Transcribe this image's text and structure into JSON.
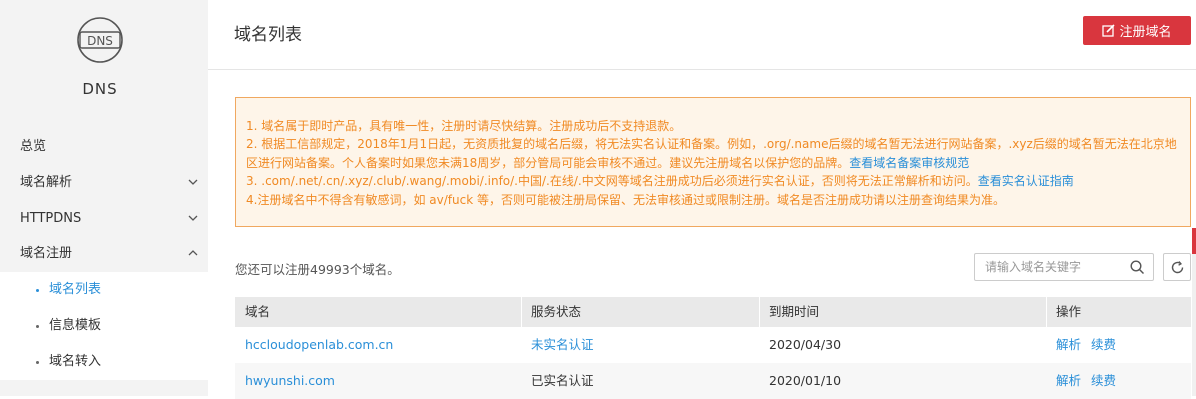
{
  "sidebar": {
    "logo_icon_text": "DNS",
    "logo_label": "DNS",
    "items": [
      {
        "label": "总览"
      },
      {
        "label": "域名解析"
      },
      {
        "label": "HTTPDNS"
      },
      {
        "label": "域名注册"
      }
    ],
    "sub_items": [
      {
        "label": "域名列表"
      },
      {
        "label": "信息模板"
      },
      {
        "label": "域名转入"
      }
    ]
  },
  "header": {
    "title": "域名列表",
    "register_button": "注册域名"
  },
  "notice": {
    "line1": "1. 域名属于即时产品，具有唯一性，注册时请尽快结算。注册成功后不支持退款。",
    "line2": "2. 根据工信部规定，2018年1月1日起，无资质批复的域名后缀，将无法实名认证和备案。例如，.org/.name后缀的域名暂无法进行网站备案，.xyz后缀的域名暂无法在北京地区进行网站备案。个人备案时如果您未满18周岁，部分管局可能会审核不通过。建议先注册域名以保护您的品牌。",
    "line2_link": "查看域名备案审核规范",
    "line3": "3. .com/.net/.cn/.xyz/.club/.wang/.mobi/.info/.中国/.在线/.中文网等域名注册成功后必须进行实名认证，否则将无法正常解析和访问。",
    "line3_link": "查看实名认证指南",
    "line4": "4.注册域名中不得含有敏感词，如 av/fuck 等，否则可能被注册局保留、无法审核通过或限制注册。域名是否注册成功请以注册查询结果为准。"
  },
  "toolbar": {
    "quota_text": "您还可以注册49993个域名。",
    "search_placeholder": "请输入域名关键字"
  },
  "table": {
    "headers": [
      "域名",
      "服务状态",
      "到期时间",
      "操作"
    ],
    "rows": [
      {
        "domain": "hccloudopenlab.com.cn",
        "status": "未实名认证",
        "expiry": "2020/04/30",
        "op1": "解析",
        "op2": "续费"
      },
      {
        "domain": "hwyunshi.com",
        "status": "已实名认证",
        "expiry": "2020/01/10",
        "op1": "解析",
        "op2": "续费"
      }
    ]
  },
  "colors": {
    "brand_red": "#d9363e",
    "link_blue": "#2a8fd8",
    "notice_orange": "#f08a24"
  }
}
